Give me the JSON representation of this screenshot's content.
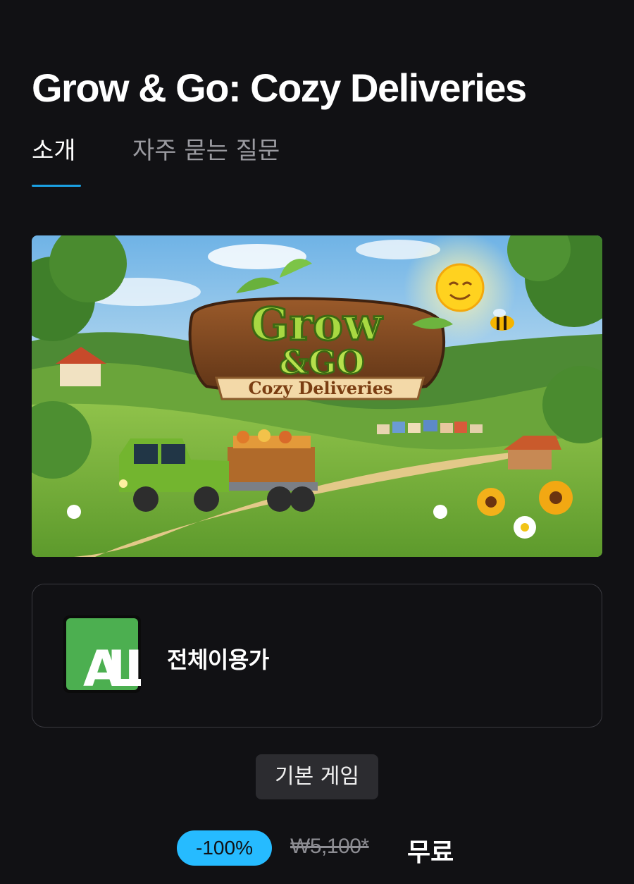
{
  "page": {
    "title": "Grow & Go: Cozy Deliveries"
  },
  "tabs": [
    {
      "label": "소개",
      "active": true
    },
    {
      "label": "자주 묻는 질문",
      "active": false
    }
  ],
  "hero": {
    "logo_line1": "Grow",
    "logo_line2": "&GO",
    "logo_subtitle": "Cozy Deliveries"
  },
  "rating": {
    "icon_text": "ALL",
    "label": "전체이용가"
  },
  "chip": {
    "label": "기본 게임"
  },
  "price": {
    "discount": "-100%",
    "original": "₩5,100*",
    "final": "무료"
  },
  "colors": {
    "background": "#111114",
    "accent": "#26bbff",
    "underline": "#1ba0e2",
    "chip": "#2c2c30",
    "rating_green": "#4caf50"
  }
}
